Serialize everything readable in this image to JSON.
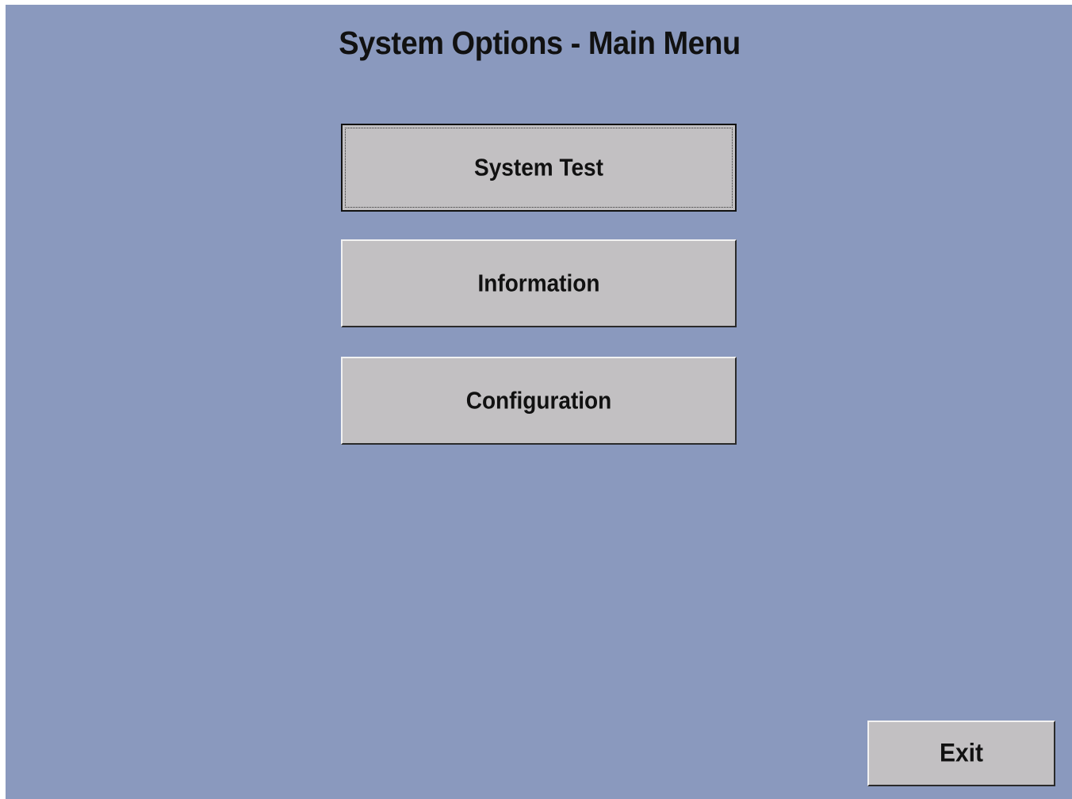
{
  "title": "System Options - Main Menu",
  "menu": {
    "items": [
      {
        "label": "System Test",
        "focused": true
      },
      {
        "label": "Information",
        "focused": false
      },
      {
        "label": "Configuration",
        "focused": false
      }
    ]
  },
  "footer": {
    "exit_label": "Exit"
  },
  "colors": {
    "background": "#8a99be",
    "button_face": "#c2c0c2",
    "text": "#111111"
  }
}
